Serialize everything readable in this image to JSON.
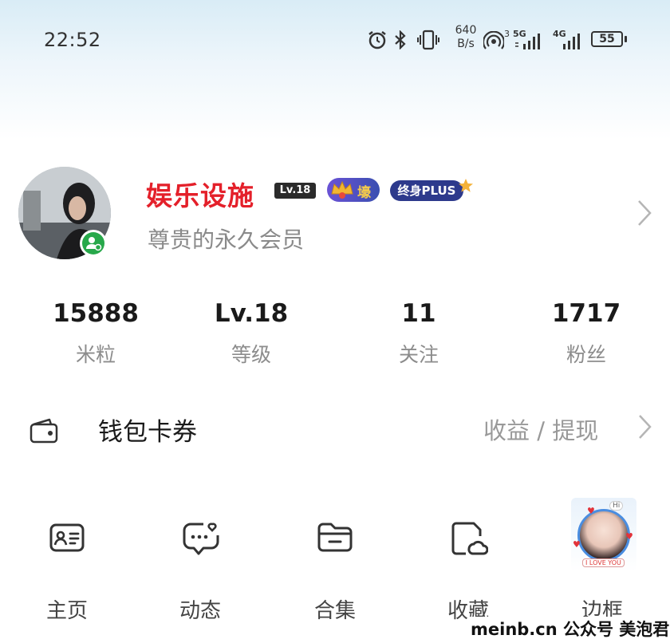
{
  "status_bar": {
    "time": "22:52",
    "net_speed_value": "640",
    "net_speed_unit": "B/s",
    "sig1_label": "5G",
    "sig1_sup": "3",
    "sig2_label": "4G",
    "battery": "55"
  },
  "profile": {
    "username": "娱乐设施",
    "level_badge": "Lv.18",
    "hao_badge": "壕",
    "plus_badge": "终身PLUS",
    "subtitle": "尊贵的永久会员"
  },
  "stats": [
    {
      "value": "15888",
      "label": "米粒"
    },
    {
      "value": "Lv.18",
      "label": "等级"
    },
    {
      "value": "11",
      "label": "关注"
    },
    {
      "value": "1717",
      "label": "粉丝"
    }
  ],
  "wallet": {
    "title": "钱包卡券",
    "right": "收益 / 提现"
  },
  "shortcuts": [
    {
      "label": "主页"
    },
    {
      "label": "动态"
    },
    {
      "label": "合集"
    },
    {
      "label": "收藏"
    },
    {
      "label": "边框"
    }
  ],
  "frame_preview": {
    "hi": "Hi",
    "tag": "I LOVE YOU"
  },
  "watermark": "meinb.cn 公众号 美泡君",
  "colors": {
    "username": "#e4202a",
    "badge_dark": "#2b2b2b",
    "plus_bg": "#2d3a8c",
    "avatar_badge": "#27a84a"
  }
}
